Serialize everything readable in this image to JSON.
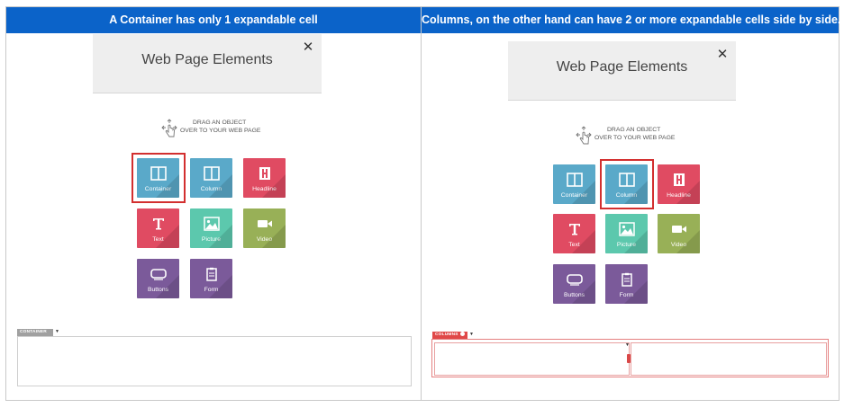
{
  "headers": {
    "left": "A Container has only 1 expandable cell",
    "right": "Columns, on the other hand can have 2 or more expandable cells side by side."
  },
  "panel": {
    "title": "Web Page Elements",
    "close_glyph": "✕"
  },
  "drag_hint": {
    "line1": "DRAG AN OBJECT",
    "line2": "OVER TO YOUR WEB PAGE"
  },
  "tiles": [
    {
      "label": "Container",
      "icon": "container-icon",
      "color": "#5aa9c9"
    },
    {
      "label": "Column",
      "icon": "column-icon",
      "color": "#5aa9c9"
    },
    {
      "label": "Headline",
      "icon": "headline-icon",
      "color": "#e04b62"
    },
    {
      "label": "Text",
      "icon": "text-icon",
      "color": "#e04b62"
    },
    {
      "label": "Picture",
      "icon": "picture-icon",
      "color": "#5cc8ad"
    },
    {
      "label": "Video",
      "icon": "video-icon",
      "color": "#98b057"
    },
    {
      "label": "Buttons",
      "icon": "buttons-icon",
      "color": "#7b5a9a"
    },
    {
      "label": "Form",
      "icon": "form-icon",
      "color": "#7b5a9a"
    }
  ],
  "left_example": {
    "selected_tile": "Container",
    "tag_label": "CONTAINER",
    "tag_color": "#a0a0a0"
  },
  "right_example": {
    "selected_tile": "Column",
    "tag_label": "COLUMNS",
    "tag_color": "#e04848"
  },
  "colors": {
    "header_bg": "#0b63c9",
    "selection_outline": "#d32f2f"
  }
}
